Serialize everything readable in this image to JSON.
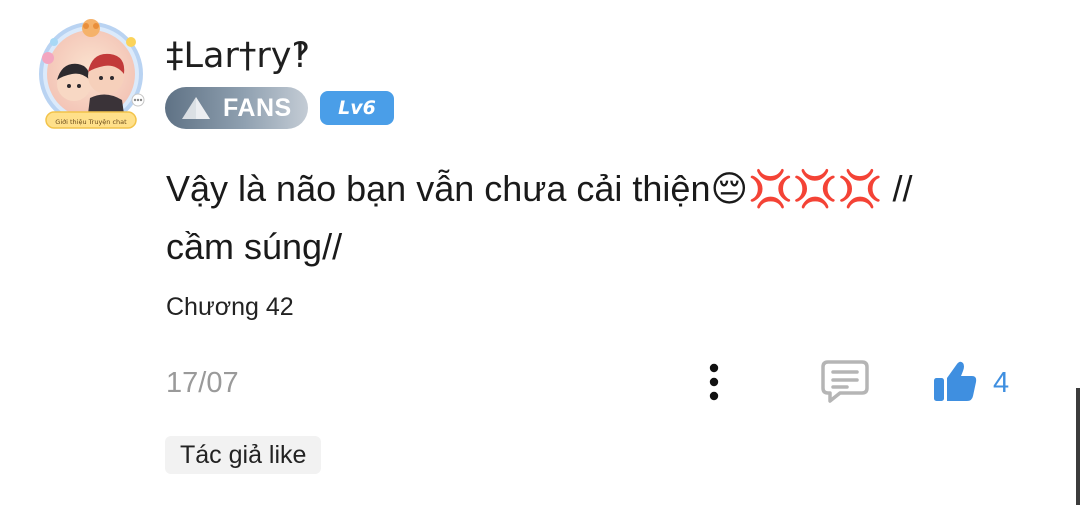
{
  "comment": {
    "username": "‡Lar†ry‽",
    "avatar_caption": "Giới thiệu Truyện chat",
    "fans_badge": "FANS",
    "level_badge": "Lv6",
    "text_line1": "Vậy là não bạn vẫn chưa cải thiện",
    "emojis": "😔💢💢💢",
    "text_line1_tail": " //",
    "text_line2": "cầm súng//",
    "chapter": "Chương 42",
    "date": "17/07",
    "like_count": "4",
    "author_tag": "Tác giả like"
  },
  "icons": {
    "more": "more-vertical-icon",
    "reply": "comment-icon",
    "like": "thumbs-up-icon",
    "badge": "triangle-icon"
  },
  "colors": {
    "accent_blue": "#3f8fe0",
    "level_badge": "#4a9ee8",
    "fans_badge_dark": "#5f7285",
    "fans_badge_light": "#c4ccd5",
    "muted_text": "#9a9a9a",
    "tag_background": "#f2f2f2"
  }
}
